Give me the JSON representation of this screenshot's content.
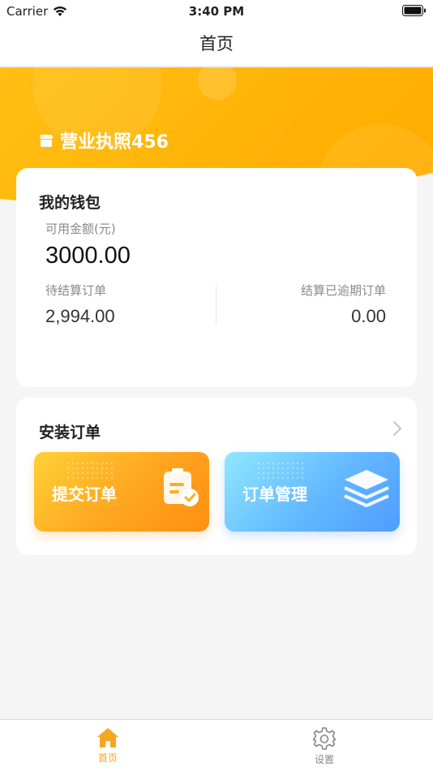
{
  "status_bar": {
    "carrier": "Carrier",
    "time": "3:40 PM"
  },
  "nav": {
    "title": "首页"
  },
  "hero": {
    "store_name": "营业执照456"
  },
  "wallet": {
    "title": "我的钱包",
    "available_label": "可用金额(元)",
    "available_value": "3000.00",
    "pending_label": "待结算订单",
    "pending_value": "2,994.00",
    "overdue_label": "结算已逾期订单",
    "overdue_value": "0.00"
  },
  "orders": {
    "title": "安装订单",
    "submit_label": "提交订单",
    "manage_label": "订单管理"
  },
  "tabs": [
    {
      "label": "首页",
      "icon": "home-icon",
      "active": true
    },
    {
      "label": "设置",
      "icon": "gear-icon",
      "active": false
    }
  ],
  "colors": {
    "accent": "#f5a623",
    "hero_yellow": "#ffb400",
    "blue_tile": "#5aa8ff",
    "orange_tile": "#ff9a18"
  }
}
